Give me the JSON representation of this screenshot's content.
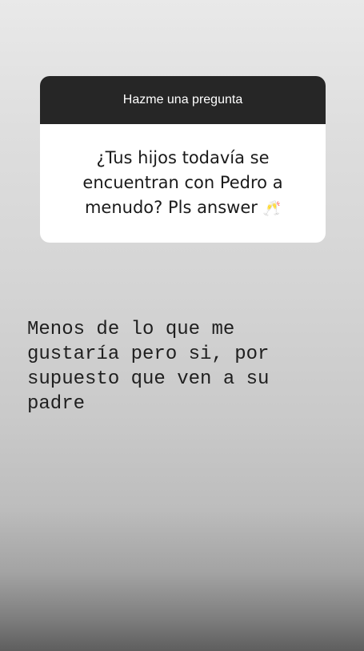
{
  "question_sticker": {
    "header": "Hazme una pregunta",
    "question": "¿Tus hijos todavía se encuentran con Pedro a menudo? Pls answer",
    "emoji": "🥂"
  },
  "answer": {
    "text": "Menos de lo que me\ngustaría pero si, por\nsupuesto que ven a su\npadre"
  },
  "colors": {
    "header_background": "#262626",
    "card_background": "#ffffff",
    "text": "#1f1f1f"
  }
}
